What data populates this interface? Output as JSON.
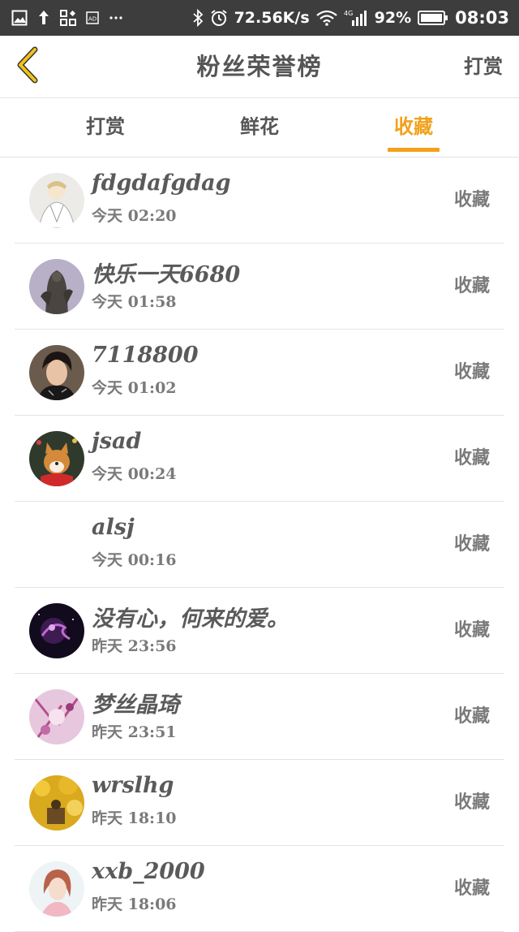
{
  "status_bar": {
    "speed": "72.56K/s",
    "network": "4G",
    "battery": "92%",
    "time": "08:03",
    "left_icons": [
      "image-icon",
      "upload-icon",
      "apps-icon",
      "ad-icon",
      "more-icon"
    ],
    "right_icons": [
      "bluetooth-icon",
      "alarm-icon",
      "wifi-icon",
      "signal-icon",
      "battery-icon"
    ]
  },
  "header": {
    "back_icon": "back-chevron-icon",
    "title": "粉丝荣誉榜",
    "action": "打赏"
  },
  "tabs": [
    {
      "label": "打赏",
      "active": false
    },
    {
      "label": "鲜花",
      "active": false
    },
    {
      "label": "收藏",
      "active": true
    }
  ],
  "list": [
    {
      "name": "fdgdafgdag",
      "time": "今天 02:20",
      "tag": "收藏"
    },
    {
      "name": "快乐一天6680",
      "time": "今天 01:58",
      "tag": "收藏"
    },
    {
      "name": "7118800",
      "time": "今天 01:02",
      "tag": "收藏"
    },
    {
      "name": "jsad",
      "time": "今天 00:24",
      "tag": "收藏"
    },
    {
      "name": "alsj",
      "time": "今天 00:16",
      "tag": "收藏"
    },
    {
      "name": "没有心，何来的爱。",
      "time": "昨天 23:56",
      "tag": "收藏"
    },
    {
      "name": "梦丝晶琦",
      "time": "昨天 23:51",
      "tag": "收藏"
    },
    {
      "name": "wrslhg",
      "time": "昨天 18:10",
      "tag": "收藏"
    },
    {
      "name": "xxb_2000",
      "time": "昨天 18:06",
      "tag": "收藏"
    }
  ],
  "colors": {
    "accent": "#f2a11a",
    "status_bar_bg": "#3d3d3d",
    "text": "#555555",
    "divider": "#e3e3e3"
  }
}
